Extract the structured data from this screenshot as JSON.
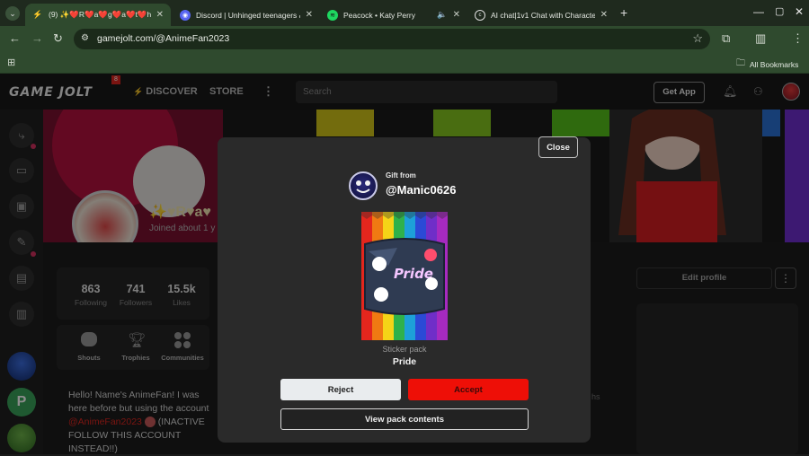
{
  "browser": {
    "tabs": [
      {
        "title": "(9) ✨❤️R❤️a❤️g❤️a❤️t❤️h❤️",
        "icon": "gamejolt-icon",
        "active": true
      },
      {
        "title": "Discord | Unhinged teenagers &",
        "icon": "discord-icon",
        "active": false
      },
      {
        "title": "Peacock • Katy Perry",
        "icon": "spotify-icon",
        "active": false,
        "audio": true
      },
      {
        "title": "AI chat|1v1 Chat with Characte",
        "icon": "character-ai-icon",
        "active": false
      }
    ],
    "url": "gamejolt.com/@AnimeFan2023",
    "bookmarks_label": "All Bookmarks"
  },
  "site": {
    "logo": "GAME JOLT",
    "logo_badge": "8",
    "nav": {
      "discover": "DISCOVER",
      "store": "STORE"
    },
    "search_placeholder": "Search",
    "get_app": "Get App"
  },
  "profile": {
    "name_partial": "✨♥R♥a♥",
    "joined_partial": "Joined about 1 y",
    "stats": [
      {
        "value": "863",
        "label": "Following"
      },
      {
        "value": "741",
        "label": "Followers"
      },
      {
        "value": "15.5k",
        "label": "Likes"
      }
    ],
    "links": [
      {
        "label": "Shouts"
      },
      {
        "label": "Trophies"
      },
      {
        "label": "Communities"
      }
    ],
    "bio_before": "Hello! Name's AnimeFan! I was here before but using the account ",
    "bio_mention": "@AnimeFan2023",
    "bio_after": " (INACTIVE FOLLOW THIS ACCOUNT INSTEAD!!)",
    "edit_profile": "Edit profile",
    "partial_text": "hs"
  },
  "modal": {
    "close_label": "Close",
    "gift_from_label": "Gift from",
    "gift_from_user": "@Manic0626",
    "pack_type_label": "Sticker pack",
    "pack_name": "Pride",
    "reject_label": "Reject",
    "accept_label": "Accept",
    "view_label": "View pack contents"
  },
  "colors": {
    "accent_red": "#ee0f07",
    "chrome_green": "#2f4a2e",
    "modal_bg": "#2a2a2a"
  }
}
